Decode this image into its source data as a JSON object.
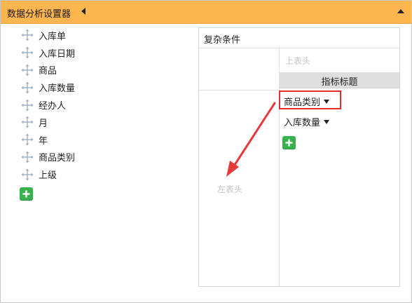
{
  "panel": {
    "title": "数据分析设置器"
  },
  "fields": [
    {
      "label": "入库单"
    },
    {
      "label": "入库日期"
    },
    {
      "label": "商品"
    },
    {
      "label": "入库数量"
    },
    {
      "label": "经办人"
    },
    {
      "label": "月"
    },
    {
      "label": "年"
    },
    {
      "label": "商品类别"
    },
    {
      "label": "上级"
    }
  ],
  "pivot": {
    "header": "复杂条件",
    "top_header_hint": "上表头",
    "metric_title": "指标标题",
    "left_header_hint": "左表头",
    "column_fields": [
      {
        "label": "商品类别"
      },
      {
        "label": "入库数量"
      }
    ]
  },
  "colors": {
    "titlebar": "#fdb54f",
    "add_button": "#37b24d",
    "highlight": "#e03030",
    "move_icon": "#9fb0c0"
  },
  "icons": {
    "field_drag": "move-arrows-icon",
    "add": "plus-icon",
    "collapse_left": "triangle-left-icon",
    "collapse_up": "triangle-up-icon"
  }
}
